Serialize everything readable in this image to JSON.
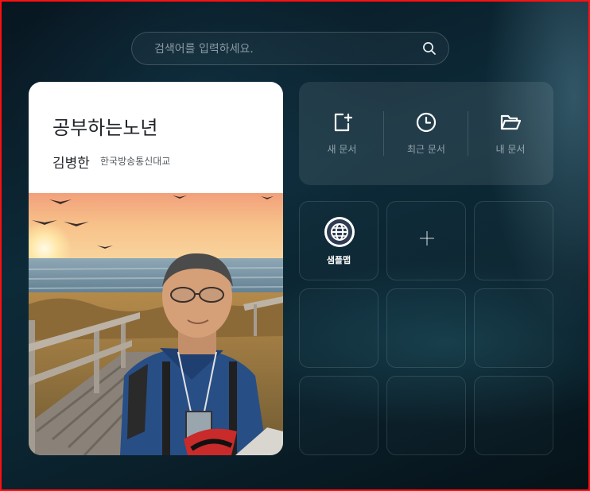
{
  "search": {
    "placeholder": "검색어를 입력하세요.",
    "value": ""
  },
  "profile": {
    "title": "공부하는노년",
    "name": "김병한",
    "organization": "한국방송통신대교"
  },
  "quick_actions": [
    {
      "label": "새 문서",
      "icon": "new-document-icon"
    },
    {
      "label": "최근 문서",
      "icon": "clock-icon"
    },
    {
      "label": "내 문서",
      "icon": "folder-open-icon"
    }
  ],
  "apps": [
    {
      "label": "샘플맵",
      "icon": "globe-icon"
    }
  ],
  "add_tile": {
    "icon": "plus-icon"
  },
  "colors": {
    "frame_border": "#ff1010",
    "background": "#0a1c26",
    "card": "#ffffff"
  }
}
